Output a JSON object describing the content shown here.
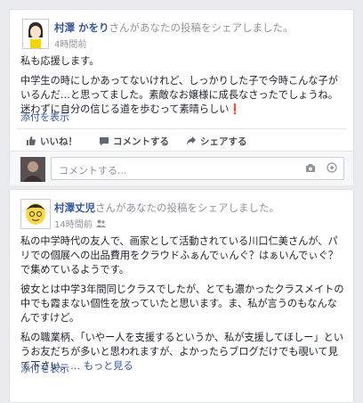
{
  "posts": [
    {
      "author": "村澤 かをり",
      "headline_suffix": "さんがあなたの投稿をシェアしました。",
      "time": "4時間前",
      "body": [
        "私も応援します。",
        "中学生の時にしかあってないけれど、しっかりした子で今時こんな子がいるんだ…と思ってました。素敵なお嬢様に成長なさったでしょうね。迷わずに自分の信じる道を歩むって素晴らしい❗"
      ],
      "see_translation": "添付を表示",
      "actions": {
        "like": "いいね！",
        "comment": "コメントする",
        "share": "シェアする"
      },
      "comment_placeholder": "コメントする..."
    },
    {
      "author": "村澤丈児",
      "headline_suffix": "さんがあなたの投稿をシェアしました。",
      "time": "14時間前",
      "body": [
        "私の中学時代の友人で、画家として活動されている川口仁美さんが、パリでの個展への出品費用をクラウドふぁんでぃんぐ？はぁいんでぃぐ？で集めているようです。",
        "彼女とは中学3年間同じクラスでしたが、とても濃かったクラスメイトの中でも霞まない個性を放っていたと思います。ま、私が言うのもなんなんですけど。",
        "私の職業柄、「いやー人を支援するというか、私が支援してほしー」というお友だちが多いと思われますが、よかったらブログだけでも覗いて見て下さい。"
      ],
      "see_more": "… もっと見る",
      "see_translation": "添付を表示"
    }
  ]
}
